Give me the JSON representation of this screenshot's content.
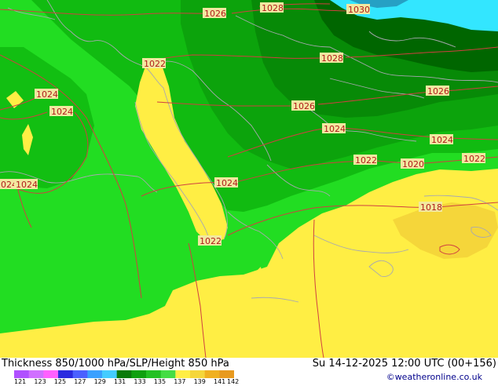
{
  "title": "Thickness 850/1000 hPa/SLP/Height 850 hPa",
  "valid_time": "Su 14-12-2025 12:00 UTC (00+156)",
  "credit": "©weatheronline.co.uk",
  "colors": {
    "yellow": "#ffee44",
    "yellow_dark": "#f5d63a",
    "green_light": "#22dd22",
    "green": "#11bb11",
    "green_mid": "#0ca30c",
    "green_dark": "#078a07",
    "green_darkest": "#006600",
    "cyan": "#33e6ff",
    "isobar": "#d04040",
    "coast": "#a8a8b0"
  },
  "isobar_labels": [
    {
      "id": "iso-1026-tl",
      "text": "1026"
    },
    {
      "id": "iso-1028-top",
      "text": "1028"
    },
    {
      "id": "iso-1030",
      "text": "1030"
    },
    {
      "id": "iso-1022-it",
      "text": "1022"
    },
    {
      "id": "iso-1028-mid",
      "text": "1028"
    },
    {
      "id": "iso-1024-w",
      "text": "1024"
    },
    {
      "id": "iso-1024-w2",
      "text": "1024"
    },
    {
      "id": "iso-1026-mid",
      "text": "1026"
    },
    {
      "id": "iso-1026-e",
      "text": "1026"
    },
    {
      "id": "iso-1024-c",
      "text": "1024"
    },
    {
      "id": "iso-1024-e",
      "text": "1024"
    },
    {
      "id": "iso-1022-c",
      "text": "1022"
    },
    {
      "id": "iso-1020",
      "text": "1020"
    },
    {
      "id": "iso-1022-e",
      "text": "1022"
    },
    {
      "id": "iso-1024-l1",
      "text": "024"
    },
    {
      "id": "iso-1024-l2",
      "text": "1024"
    },
    {
      "id": "iso-1024-it",
      "text": "1024"
    },
    {
      "id": "iso-1018",
      "text": "1018"
    },
    {
      "id": "iso-1022-s",
      "text": "1022"
    }
  ],
  "legend": {
    "colors": [
      "#b050ff",
      "#d070ff",
      "#ff60ff",
      "#2a2adf",
      "#4a60ff",
      "#3aa0ff",
      "#44ccff",
      "#0a7a0a",
      "#0ea00e",
      "#22c022",
      "#44dd44",
      "#ffee44",
      "#f5d63a",
      "#f0b020",
      "#e89a20"
    ],
    "labels": [
      "121",
      "123",
      "125",
      "127",
      "129",
      "131",
      "133",
      "135",
      "137",
      "139",
      "141",
      "142"
    ]
  }
}
